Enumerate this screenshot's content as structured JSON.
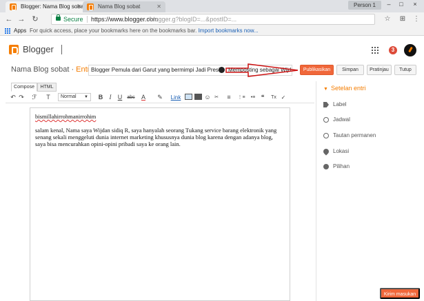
{
  "browser": {
    "tabs": [
      {
        "title": "Blogger: Nama Blog sobat",
        "active": true
      },
      {
        "title": "Nama Blog sobat",
        "active": false
      }
    ],
    "profile_label": "Person 1",
    "window_controls": [
      "–",
      "□",
      "×"
    ],
    "secure_label": "Secure",
    "url_prefix": "https://www.blogger.com",
    "url_rest": "/blogger.g?blogID=...&postID=...",
    "bookmarks": {
      "apps_label": "Apps",
      "message": "For quick access, place your bookmarks here on the bookmarks bar.",
      "import_link": "Import bookmarks now..."
    }
  },
  "header": {
    "logo_text": "Blogger",
    "notification_count": "3"
  },
  "post": {
    "blog_name": "Nama Blog sobat",
    "entry_label": "Entri",
    "title_value": "Blogger Pemula dari Garut yang bermimpi Jadi Presid",
    "title_hint": "Memposting sebagai Wijdan"
  },
  "actions": {
    "publish": "Publikasikan",
    "save": "Simpan",
    "preview": "Pratinjau",
    "close": "Tutup"
  },
  "editor": {
    "mode_tabs": [
      "Compose",
      "HTML"
    ],
    "format_select": "Normal",
    "toolbar": {
      "undo": "↶",
      "redo": "↷",
      "font": "ℱ",
      "size": "T",
      "bold": "B",
      "italic": "I",
      "underline": "U",
      "strike": "abc",
      "text_color": "A",
      "highlight": "✎",
      "link": "Link",
      "emoji": "☺",
      "align": "≡",
      "numbered": "⋮≡",
      "bulleted": "•≡",
      "quote": "❝",
      "clear": "Tx"
    },
    "content": {
      "heading_line": "bismillahirrohmanirrohim",
      "paragraph": "salam kenal, Nama saya Wijdan sidiq R, saya hanyalah seorang Tukang service barang elektronik yang senang sekali menggeluti dunia internet marketing khususnya dunia blog karena dengan adanya blog, saya bisa mencurahkan opini-opini pribadi saya ke orang lain."
    }
  },
  "settings": {
    "heading": "Setelan entri",
    "items": [
      {
        "label": "Label",
        "icon": "tag-icon"
      },
      {
        "label": "Jadwal",
        "icon": "clock-icon"
      },
      {
        "label": "Tautan permanen",
        "icon": "link-icon"
      },
      {
        "label": "Lokasi",
        "icon": "location-pin-icon"
      },
      {
        "label": "Pilihan",
        "icon": "gear-icon"
      }
    ]
  },
  "feedback_label": "Kirim masukan",
  "colors": {
    "accent": "#f57d00",
    "publish_button": "#f0673a",
    "secure_green": "#0b8043",
    "annotation_arrow": "#cc1111"
  }
}
